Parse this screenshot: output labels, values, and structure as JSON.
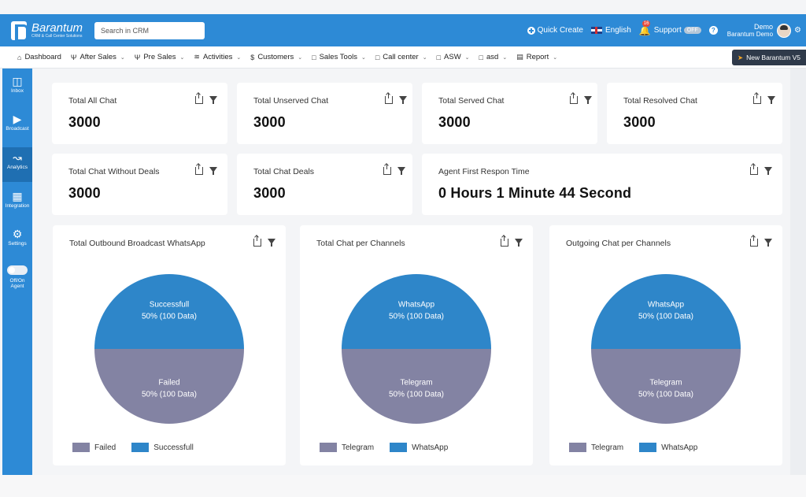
{
  "app": {
    "name": "Barantum",
    "tagline": "CRM & Call Center Solutions"
  },
  "topbar": {
    "search_placeholder": "Search in CRM",
    "quick_create": "Quick Create",
    "language": "English",
    "notification_count": "16",
    "support": "Support",
    "support_state": "OFF",
    "help": "?",
    "user_name": "Demo",
    "user_org": "Barantum Demo"
  },
  "menu": [
    {
      "icon": "home-icon",
      "label": "Dashboard",
      "dropdown": false
    },
    {
      "icon": "users-icon",
      "label": "After Sales",
      "dropdown": true
    },
    {
      "icon": "users-icon",
      "label": "Pre Sales",
      "dropdown": true
    },
    {
      "icon": "activity-icon",
      "label": "Activities",
      "dropdown": true
    },
    {
      "icon": "dollar-icon",
      "label": "Customers",
      "dropdown": true
    },
    {
      "icon": "folder-icon",
      "label": "Sales Tools",
      "dropdown": true
    },
    {
      "icon": "folder-icon",
      "label": "Call center",
      "dropdown": true
    },
    {
      "icon": "folder-icon",
      "label": "ASW",
      "dropdown": true
    },
    {
      "icon": "folder-icon",
      "label": "asd",
      "dropdown": true
    },
    {
      "icon": "chart-icon",
      "label": "Report",
      "dropdown": true
    }
  ],
  "new_version_button": "New Barantum V5",
  "sidebar": [
    {
      "icon": "chat-icon",
      "label": "Inbox",
      "active": false
    },
    {
      "icon": "megaphone-icon",
      "label": "Broadcast",
      "active": false
    },
    {
      "icon": "line-chart-icon",
      "label": "Analytics",
      "active": true
    },
    {
      "icon": "grid-icon",
      "label": "Integration",
      "active": false
    },
    {
      "icon": "gear-icon",
      "label": "Settings",
      "active": false
    }
  ],
  "agent_toggle": {
    "label_line1": "Off/On",
    "label_line2": "Agent"
  },
  "stats": [
    {
      "title": "Total All Chat",
      "value": "3000"
    },
    {
      "title": "Total Unserved Chat",
      "value": "3000"
    },
    {
      "title": "Total Served Chat",
      "value": "3000"
    },
    {
      "title": "Total Resolved Chat",
      "value": "3000"
    },
    {
      "title": "Total Chat Without Deals",
      "value": "3000"
    },
    {
      "title": "Total Chat Deals",
      "value": "3000"
    },
    {
      "title": "Agent First Respon Time",
      "value": "0 Hours 1 Minute 44 Second"
    }
  ],
  "colors": {
    "primary": "#2d8ad6",
    "pie_blue": "#2e86c9",
    "pie_gray": "#8383a3"
  },
  "chart_data": [
    {
      "type": "pie",
      "title": "Total Outbound Broadcast WhatsApp",
      "slices": [
        {
          "name": "Successfull",
          "value": 100,
          "label": "50% (100 Data)",
          "color": "#2e86c9"
        },
        {
          "name": "Failed",
          "value": 100,
          "label": "50% (100 Data)",
          "color": "#8383a3"
        }
      ],
      "legend": [
        "Failed",
        "Successfull"
      ],
      "legend_placement": "bottom"
    },
    {
      "type": "pie",
      "title": "Total Chat per Channels",
      "slices": [
        {
          "name": "WhatsApp",
          "value": 100,
          "label": "50% (100 Data)",
          "color": "#2e86c9"
        },
        {
          "name": "Telegram",
          "value": 100,
          "label": "50% (100 Data)",
          "color": "#8383a3"
        }
      ],
      "legend": [
        "Telegram",
        "WhatsApp"
      ],
      "legend_placement": "bottom"
    },
    {
      "type": "pie",
      "title": "Outgoing Chat per Channels",
      "slices": [
        {
          "name": "WhatsApp",
          "value": 100,
          "label": "50% (100 Data)",
          "color": "#2e86c9"
        },
        {
          "name": "Telegram",
          "value": 100,
          "label": "50% (100 Data)",
          "color": "#8383a3"
        }
      ],
      "legend": [
        "Telegram",
        "WhatsApp"
      ],
      "legend_placement": "bottom"
    }
  ]
}
